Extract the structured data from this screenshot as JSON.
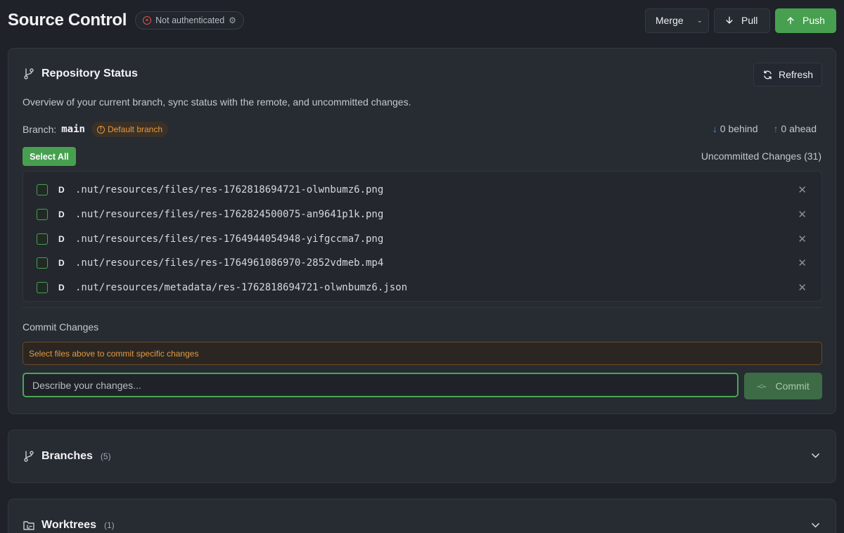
{
  "header": {
    "title": "Source Control",
    "auth_status": "Not authenticated",
    "merge_label": "Merge",
    "pull_label": "Pull",
    "push_label": "Push"
  },
  "repo": {
    "title": "Repository Status",
    "refresh_label": "Refresh",
    "description": "Overview of your current branch, sync status with the remote, and uncommitted changes.",
    "branch_label": "Branch:",
    "branch_name": "main",
    "default_badge": "Default branch",
    "behind": "0 behind",
    "ahead": "0 ahead",
    "select_all_label": "Select All",
    "uncommitted_label": "Uncommitted Changes (31)",
    "files": [
      {
        "status": "D",
        "path": ".nut/resources/files/res-1762818694721-olwnbumz6.png"
      },
      {
        "status": "D",
        "path": ".nut/resources/files/res-1762824500075-an9641p1k.png"
      },
      {
        "status": "D",
        "path": ".nut/resources/files/res-1764944054948-yifgccma7.png"
      },
      {
        "status": "D",
        "path": ".nut/resources/files/res-1764961086970-2852vdmeb.mp4"
      },
      {
        "status": "D",
        "path": ".nut/resources/metadata/res-1762818694721-olwnbumz6.json"
      }
    ],
    "commit_label": "Commit Changes",
    "warning": "Select files above to commit specific changes",
    "commit_placeholder": "Describe your changes...",
    "commit_button": "Commit"
  },
  "branches": {
    "title": "Branches",
    "count": "(5)"
  },
  "worktrees": {
    "title": "Worktrees",
    "count": "(1)"
  },
  "colors": {
    "accent": "#47a04f",
    "warning": "#e29a44",
    "error": "#e5534b",
    "behind": "#4f8ff0"
  }
}
